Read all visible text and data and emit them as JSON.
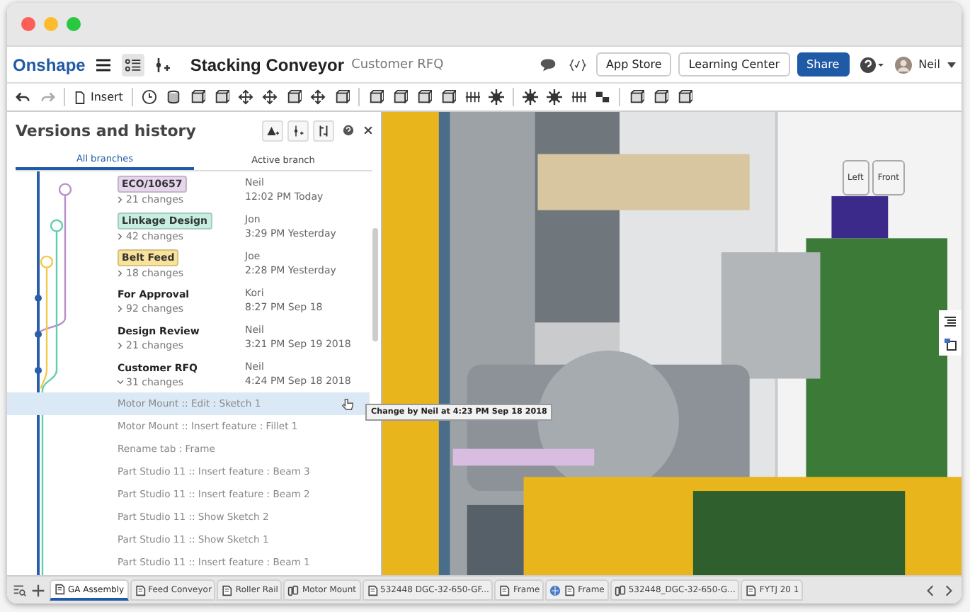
{
  "app": {
    "logo": "Onshape",
    "title": "Stacking Conveyor",
    "subtitle": "Customer RFQ",
    "user": "Neil",
    "buttons": [
      {
        "label": "App Store",
        "kind": "plain"
      },
      {
        "label": "Learning Center",
        "kind": "plain"
      },
      {
        "label": "Share",
        "kind": "primary"
      }
    ]
  },
  "toolbar": {
    "insert_label": "Insert"
  },
  "panel": {
    "title": "Versions and history",
    "tabs": [
      {
        "label": "All branches",
        "selected": true
      },
      {
        "label": "Active branch",
        "selected": false
      }
    ],
    "versions": [
      {
        "name": "ECO/10657",
        "color": "#e6d5ec",
        "changes": "21 changes",
        "author": "Neil",
        "time": "12:02 PM Today",
        "expanded": false
      },
      {
        "name": "Linkage Design",
        "color": "#c6efe2",
        "changes": "42 changes",
        "author": "Jon",
        "time": "3:29 PM Yesterday",
        "expanded": false
      },
      {
        "name": "Belt Feed",
        "color": "#f9e39a",
        "changes": "18 changes",
        "author": "Joe",
        "time": "2:28 PM Yesterday",
        "expanded": false
      },
      {
        "name": "For Approval",
        "changes": "92 changes",
        "author": "Kori",
        "time": "8:27 PM Sep 18",
        "expanded": false
      },
      {
        "name": "Design Review",
        "changes": "21 changes",
        "author": "Neil",
        "time": "3:21 PM Sep 19 2018",
        "expanded": false
      },
      {
        "name": "Customer RFQ",
        "changes": "31 changes",
        "author": "Neil",
        "time": "4:24 PM Sep 18 2018",
        "expanded": true
      }
    ],
    "history": [
      {
        "text": "Motor Mount :: Edit : Sketch 1",
        "selected": true
      },
      {
        "text": "Motor Mount :: Insert feature : Fillet 1",
        "selected": false
      },
      {
        "text": "Rename tab : Frame",
        "selected": false
      },
      {
        "text": "Part Studio 11 :: Insert feature : Beam 3",
        "selected": false
      },
      {
        "text": "Part Studio 11 :: Insert feature : Beam 2",
        "selected": false
      },
      {
        "text": "Part Studio 11 :: Show Sketch 2",
        "selected": false
      },
      {
        "text": "Part Studio 11 :: Show Sketch 1",
        "selected": false
      },
      {
        "text": "Part Studio 11 :: Insert feature : Beam 1",
        "selected": false
      }
    ],
    "tooltip": "Change by Neil at 4:23 PM Sep 18 2018"
  },
  "viewport": {
    "view_cube": [
      "Left",
      "Front"
    ]
  },
  "tabs": [
    {
      "label": "GA Assembly",
      "kind": "part-studio",
      "selected": true
    },
    {
      "label": "Feed Conveyor",
      "kind": "part-studio",
      "selected": false
    },
    {
      "label": "Roller Rail",
      "kind": "part-studio",
      "selected": false
    },
    {
      "label": "Motor Mount",
      "kind": "assembly",
      "selected": false
    },
    {
      "label": "532448 DGC-32-650-GF...",
      "kind": "part-studio",
      "selected": false
    },
    {
      "label": "Frame",
      "kind": "part-studio",
      "selected": false
    },
    {
      "label": "Frame",
      "kind": "linked",
      "selected": false
    },
    {
      "label": "532448_DGC-32-650-G...",
      "kind": "assembly",
      "selected": false
    },
    {
      "label": "FYTJ 20 1",
      "kind": "part-studio",
      "selected": false
    }
  ]
}
